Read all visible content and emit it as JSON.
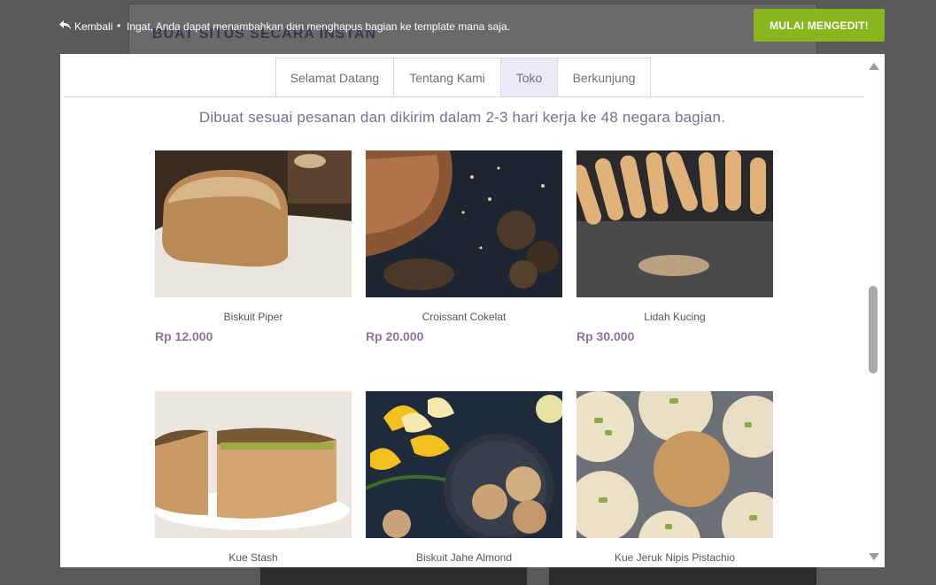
{
  "background": {
    "title": "BUAT SITUS SECARA INSTAN"
  },
  "topbar": {
    "back_label": "Kembali",
    "separator": "•",
    "message": "Ingat, Anda dapat menambahkan dan menghapus bagian ke template mana saja.",
    "start_button": "MULAI MENGEDIT!"
  },
  "tabs": [
    {
      "label": "Selamat Datang"
    },
    {
      "label": "Tentang Kami"
    },
    {
      "label": "Toko"
    },
    {
      "label": "Berkunjung"
    }
  ],
  "active_tab": "Toko",
  "shop": {
    "subtitle": "Dibuat sesuai pesanan dan dikirim dalam 2-3 hari kerja ke 48 negara bagian.",
    "products": [
      {
        "name": "Biskuit Piper",
        "price": "Rp 12.000"
      },
      {
        "name": "Croissant Cokelat",
        "price": "Rp 20.000"
      },
      {
        "name": "Lidah Kucing",
        "price": "Rp 30.000"
      },
      {
        "name": "Kue Stash",
        "price": ""
      },
      {
        "name": "Biskuit Jahe Almond",
        "price": ""
      },
      {
        "name": "Kue Jeruk Nipis Pistachio",
        "price": ""
      }
    ]
  },
  "colors": {
    "accent_green": "#8ab61d",
    "price_purple": "#8a72a6",
    "subtitle_purple": "#7a6e96"
  }
}
